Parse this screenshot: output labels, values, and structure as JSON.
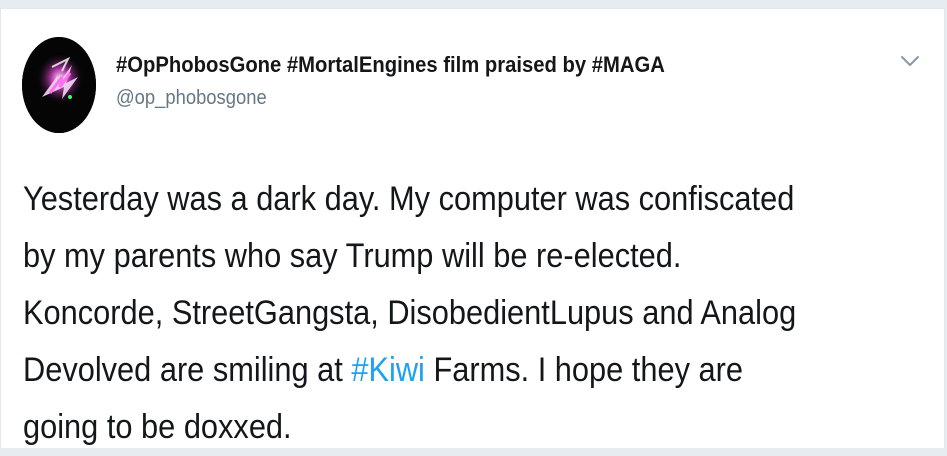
{
  "tweet": {
    "display_name": "#OpPhobosGone #MortalEngines film praised by #MAGA",
    "username": "@op_phobosgone",
    "lines": [
      "Yesterday was a dark day. My computer was confiscated",
      "by my parents who say Trump will be re-elected.",
      "Koncorde, StreetGangsta, DisobedientLupus and Analog"
    ],
    "line4_before": "Devolved are smiling at ",
    "line4_hashtag": "#Kiwi",
    "line4_after": " Farms. I hope they are",
    "line5": "going to be doxxed."
  },
  "icons": {
    "avatar": "stylized-emblem-avatar",
    "menu": "chevron-down-icon"
  },
  "colors": {
    "text": "#14171a",
    "secondary": "#657786",
    "link": "#1da1f2",
    "card_background": "#ffffff",
    "page_background": "#e6ecf0"
  }
}
